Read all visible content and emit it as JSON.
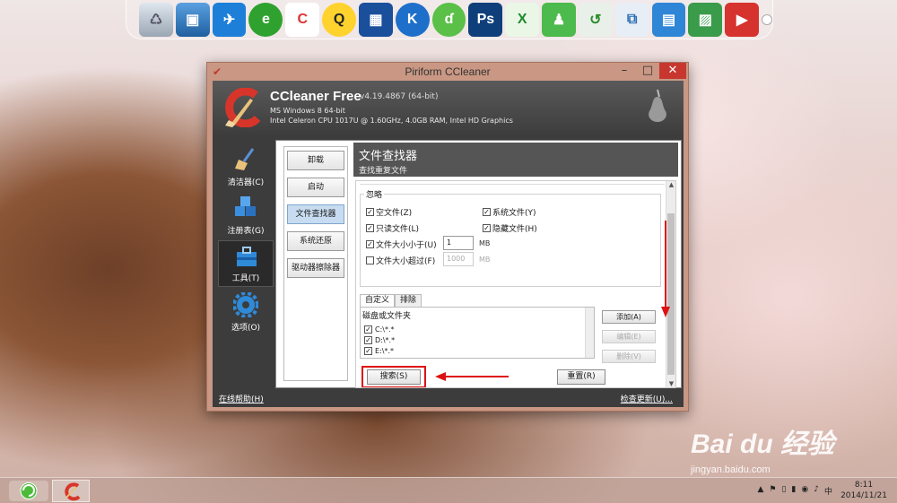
{
  "window": {
    "title": "Piriform CCleaner",
    "product_name": "CCleaner Free",
    "version": "v4.19.4867 (64-bit)",
    "os_info": "MS Windows 8 64-bit",
    "hw_info": "Intel Celeron CPU 1017U @ 1.60GHz, 4.0GB RAM, Intel HD Graphics",
    "controls": {
      "minimize": "–",
      "maximize": "□",
      "close": "✕"
    }
  },
  "sidebar": {
    "items": [
      {
        "label": "清洁器(C)",
        "icon": "broom-icon"
      },
      {
        "label": "注册表(G)",
        "icon": "registry-cubes-icon"
      },
      {
        "label": "工具(T)",
        "icon": "toolbox-icon"
      },
      {
        "label": "选项(O)",
        "icon": "gear-icon"
      }
    ],
    "active_index": 2,
    "help_link": "在线帮助(H)"
  },
  "footer": {
    "update_link": "检查更新(U)..."
  },
  "tools_nav": {
    "items": [
      "卸载",
      "启动",
      "文件查找器",
      "系统还原",
      "驱动器擦除器"
    ],
    "active_index": 2
  },
  "finder": {
    "title": "文件查找器",
    "subtitle": "查找重复文件",
    "ignore_group": {
      "title": "忽略",
      "zero_files": "空文件(Z)",
      "system_files": "系统文件(Y)",
      "readonly_files": "只读文件(L)",
      "hidden_files": "隐藏文件(H)",
      "smaller_than": "文件大小小于(U)",
      "smaller_value": "1",
      "larger_than": "文件大小超过(F)",
      "larger_value": "1000",
      "unit": "MB"
    },
    "tabs": [
      "自定义",
      "排除"
    ],
    "list_header": "磁盘或文件夹",
    "paths": [
      "C:\\*.*",
      "D:\\*.*",
      "E:\\*.*"
    ],
    "buttons": {
      "add": "添加(A)",
      "edit": "编辑(E)",
      "delete": "删除(V)",
      "search": "搜索(S)",
      "reset": "重置(R)"
    }
  },
  "taskbar": {
    "time": "8:11",
    "date": "2014/11/21",
    "tray": [
      "▲",
      "⚑",
      "▯",
      "▮",
      "◉",
      "♪",
      "中"
    ]
  },
  "watermark": {
    "brand": "Bai du 经验",
    "url": "jingyan.baidu.com"
  },
  "colors": {
    "accent_red": "#d11111",
    "panel_header": "#555555",
    "title_bar": "#c99783",
    "close_red": "#c7372f"
  }
}
